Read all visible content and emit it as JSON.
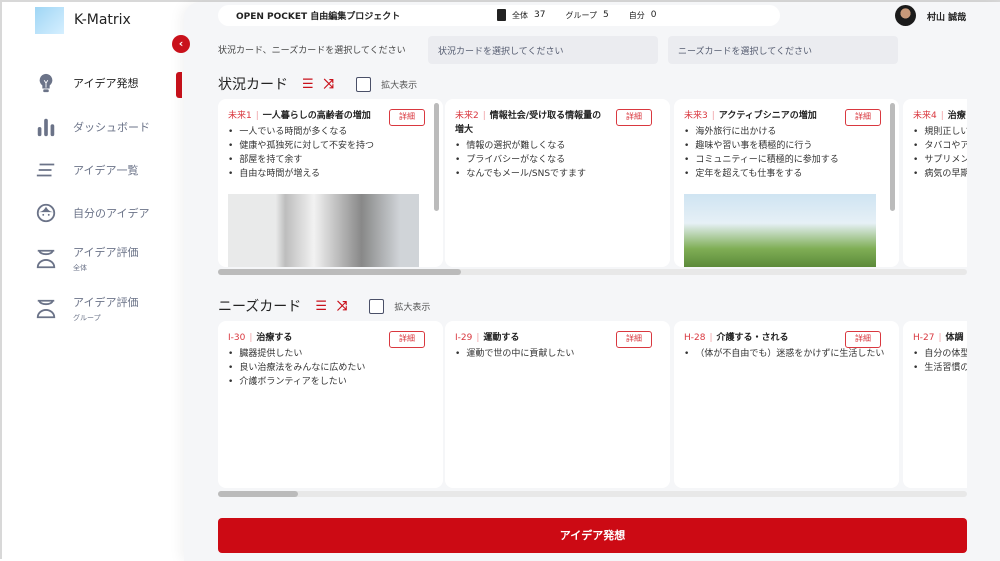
{
  "app": {
    "name": "K-Matrix"
  },
  "sidebar": {
    "items": [
      {
        "label": "アイデア発想",
        "icon": "lightbulb-icon",
        "active": true
      },
      {
        "label": "ダッシュボード",
        "icon": "bar-chart-icon"
      },
      {
        "label": "アイデア一覧",
        "icon": "list-icon"
      },
      {
        "label": "自分のアイデア",
        "icon": "face-icon"
      },
      {
        "label": "アイデア評価",
        "sub": "全体",
        "icon": "scale-icon"
      },
      {
        "label": "アイデア評価",
        "sub": "グループ",
        "icon": "scale-icon"
      }
    ]
  },
  "header": {
    "project": "OPEN POCKET 自由編集プロジェクト",
    "stats": [
      {
        "label": "全体",
        "value": "37"
      },
      {
        "label": "グループ",
        "value": "5"
      },
      {
        "label": "自分",
        "value": "0"
      }
    ],
    "user": "村山 誠哉"
  },
  "selection": {
    "hint": "状況カード、ニーズカードを選択してください",
    "situation_placeholder": "状況カードを選択してください",
    "needs_placeholder": "ニーズカードを選択してください"
  },
  "situation": {
    "title": "状況カード",
    "zoom_label": "拡大表示",
    "detail_label": "詳細",
    "cards": [
      {
        "id": "未来1",
        "title": "一人暮らしの高齢者の増加",
        "items": [
          "一人でいる時間が多くなる",
          "健康や孤独死に対して不安を持つ",
          "部屋を持て余す",
          "自由な時間が増える"
        ],
        "image": true
      },
      {
        "id": "未来2",
        "title": "情報社会/受け取る情報量の増大",
        "items": [
          "情報の選択が難しくなる",
          "プライバシーがなくなる",
          "なんでもメール/SNSですます"
        ]
      },
      {
        "id": "未来3",
        "title": "アクティブシニアの増加",
        "items": [
          "海外旅行に出かける",
          "趣味や習い事を積極的に行う",
          "コミュニティーに積極的に参加する",
          "定年を超えても仕事をする"
        ],
        "image": true
      },
      {
        "id": "未来4",
        "title": "治療",
        "items": [
          "規則正しい",
          "タバコやア",
          "サプリメン",
          "病気の早期"
        ]
      }
    ]
  },
  "needs": {
    "title": "ニーズカード",
    "zoom_label": "拡大表示",
    "detail_label": "詳細",
    "cards": [
      {
        "id": "I-30",
        "title": "治療する",
        "items": [
          "臓器提供したい",
          "良い治療法をみんなに広めたい",
          "介護ボランティアをしたい"
        ]
      },
      {
        "id": "I-29",
        "title": "運動する",
        "items": [
          "運動で世の中に貢献したい"
        ]
      },
      {
        "id": "H-28",
        "title": "介護する・される",
        "items": [
          "（体が不自由でも）迷惑をかけずに生活したい"
        ]
      },
      {
        "id": "H-27",
        "title": "体調",
        "items": [
          "自分の体型",
          "生活習慣の"
        ]
      }
    ]
  },
  "action": {
    "generate_label": "アイデア発想"
  },
  "colors": {
    "accent": "#cc0a14",
    "sidebar_text": "#6b7388"
  }
}
